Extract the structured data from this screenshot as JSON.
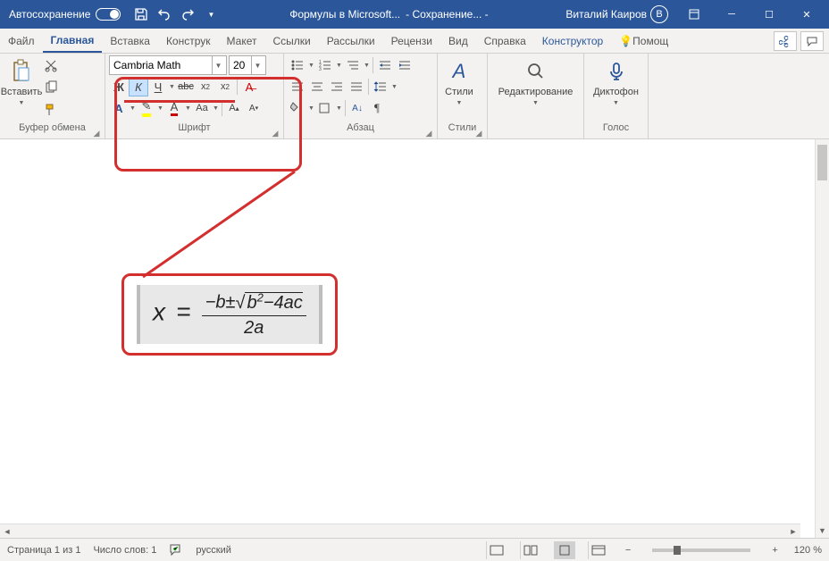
{
  "titlebar": {
    "autosave_label": "Автосохранение",
    "doc_title": "Формулы в Microsoft...",
    "save_status": "Сохранение...",
    "user_name": "Виталий Каиров"
  },
  "tabs": {
    "file": "Файл",
    "home": "Главная",
    "insert": "Вставка",
    "design": "Конструк",
    "layout": "Макет",
    "references": "Ссылки",
    "mailings": "Рассылки",
    "review": "Рецензи",
    "view": "Вид",
    "help": "Справка",
    "equation": "Конструктор",
    "tell_me": "Помощ"
  },
  "ribbon": {
    "clipboard": {
      "label": "Буфер обмена",
      "paste": "Вставить"
    },
    "font": {
      "label": "Шрифт",
      "name": "Cambria Math",
      "size": "20",
      "bold": "Ж",
      "italic": "К",
      "underline": "Ч",
      "strike": "abc",
      "sub": "x₂",
      "sup": "x²"
    },
    "paragraph": {
      "label": "Абзац"
    },
    "styles": {
      "label": "Стили",
      "btn": "Стили"
    },
    "editing": {
      "label": "Редактирование"
    },
    "voice": {
      "label": "Голос",
      "btn": "Диктофон"
    }
  },
  "equation": {
    "lhs": "x",
    "eq": "=",
    "num_prefix": "−b±",
    "rad_b": "b",
    "rad_sup": "2",
    "rad_rest": "−4ac",
    "den": "2a"
  },
  "status": {
    "page": "Страница 1 из 1",
    "words": "Число слов: 1",
    "lang": "русский",
    "zoom": "120 %"
  }
}
